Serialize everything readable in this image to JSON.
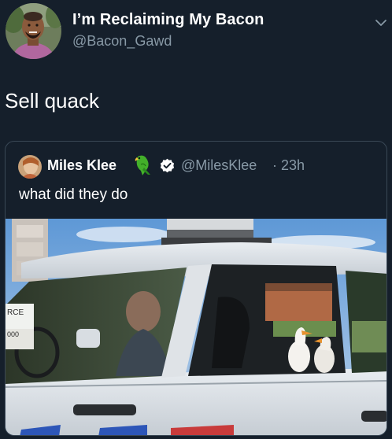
{
  "tweet": {
    "author": {
      "display_name": "I’m Reclaiming My Bacon",
      "handle": "@Bacon_Gawd"
    },
    "text": "Sell quack",
    "quoted_tweet": {
      "author": {
        "display_name": "Miles Klee",
        "handle": "@MilesKlee",
        "verified": true
      },
      "separator": "·",
      "time": "23h",
      "text": "what did they do",
      "photo_signs": {
        "sign_left": "RCE",
        "sign_left_number": "000"
      }
    }
  },
  "icons": {
    "caret": "chevron-down-icon",
    "verified": "verified-badge-icon",
    "emoji": "parrot-emoji-icon"
  },
  "colors": {
    "background": "#151f2b",
    "secondary_text": "#8899a6",
    "card_border": "#3a4856"
  }
}
